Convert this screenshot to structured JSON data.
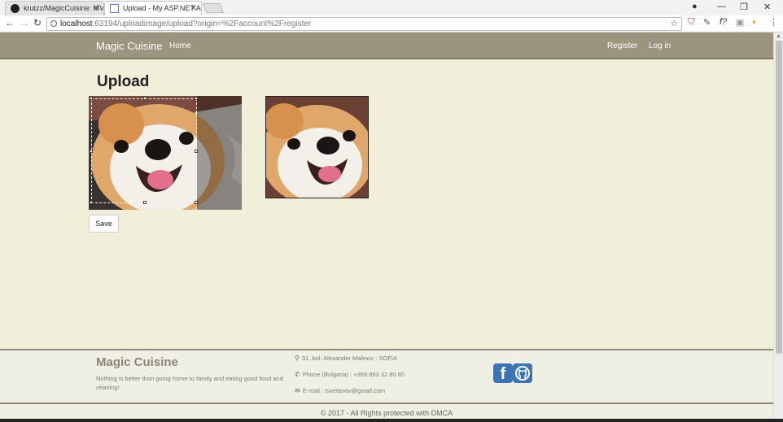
{
  "browser": {
    "tabs": [
      {
        "title": "krutzz/MagicCuisine: MV"
      },
      {
        "title": "Upload - My ASP.NET Ap"
      }
    ],
    "url_host": "localhost",
    "url_rest": ":63194/uploadimage/upload?origin=%2Faccount%2Fregister"
  },
  "navbar": {
    "brand": "Magic Cuisine",
    "links": [
      "Home"
    ],
    "right_links": [
      "Register",
      "Log in"
    ],
    "background": "#9b9580"
  },
  "main": {
    "title": "Upload",
    "save_label": "Save"
  },
  "footer": {
    "brand": "Magic Cuisine",
    "tagline": "Nothing is better than going home to family and eating good food and relaxing!",
    "address": "31, bul. Alexander Malinov - SOFIA",
    "phone": "Phone (Bulgaria) : +359 893 32 80 60",
    "email": "E-mail : tsvetanov@gmail.com",
    "copyright": "2017 - All Rights protected with DMCA",
    "social_icons": [
      "facebook-icon",
      "github-icon"
    ]
  }
}
